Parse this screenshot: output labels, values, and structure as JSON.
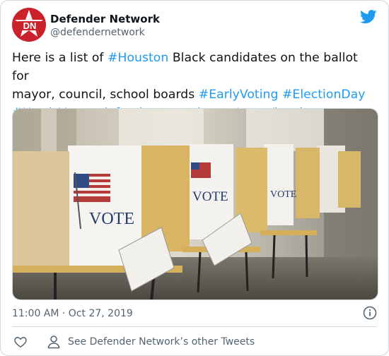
{
  "author": {
    "display_name": "Defender Network",
    "handle": "@defendernetwork",
    "avatar_text": "DN"
  },
  "tweet": {
    "line1_plain_a": "Here is a list of ",
    "line1_hashtag_houston": "#Houston",
    "line1_plain_b": " Black candidates on the ballot for",
    "line2_plain": "mayor, council, school boards ",
    "line2_hashtag_early": "#EarlyVoting",
    "line2_hashtag_election": "#ElectionDay",
    "line3_hashtag_harris": "#HarrisVotes",
    "line3_link": "defendernetwork.com/news/local-sta…"
  },
  "media": {
    "sign_text": "VOTE"
  },
  "meta": {
    "timestamp": "11:00 AM · Oct 27, 2019"
  },
  "actions": {
    "other_tweets_label": "See Defender Network’s other Tweets"
  },
  "colors": {
    "link": "#1d9bf0",
    "secondary_text": "#536471",
    "border": "#cfd9de",
    "brand_red": "#c9222a"
  },
  "icons": {
    "twitter": "twitter-bird-icon",
    "info": "info-icon",
    "like": "heart-icon",
    "person": "person-icon"
  }
}
